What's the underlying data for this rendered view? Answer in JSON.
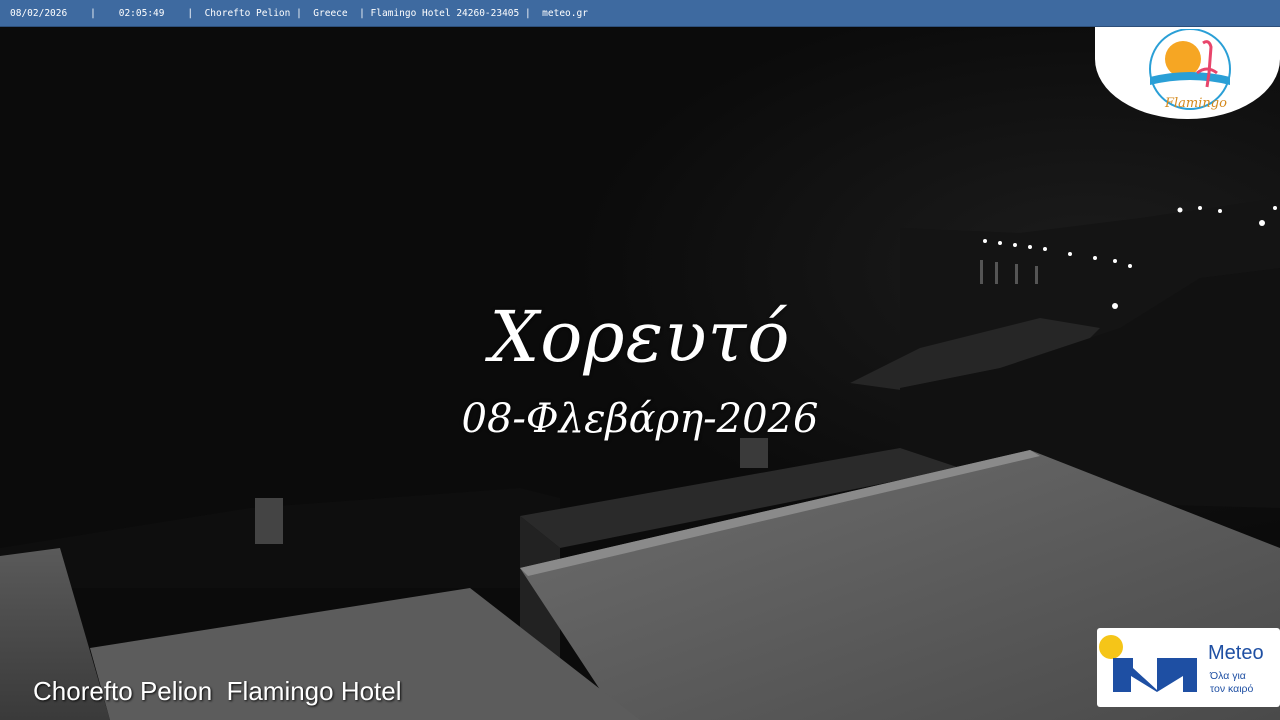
{
  "info_bar": {
    "date": "08/02/2026",
    "time": "02:05:49",
    "location": "Chorefto Pelion",
    "country": "Greece",
    "hotel": "Flamingo Hotel 24260-23405",
    "source": "meteo.gr",
    "separator": "|"
  },
  "overlay": {
    "place_name": "Χορευτό",
    "date_text": "08-Φλεβάρη-2026"
  },
  "caption": "Chorefto Pelion  Flamingo Hotel",
  "hotel_logo": {
    "brand": "Flamingo",
    "colors": {
      "sun": "#f6a623",
      "sea": "#2a9fd6",
      "flamingo": "#e8456b",
      "text": "#d4891c"
    }
  },
  "meteo_logo": {
    "name": "Meteo",
    "tagline_line1": "Όλα για",
    "tagline_line2": "τον καιρό",
    "colors": {
      "blue": "#1e4fa3",
      "yellow": "#f5c518"
    }
  },
  "theme": {
    "bar_color": "#3e6aa0"
  }
}
